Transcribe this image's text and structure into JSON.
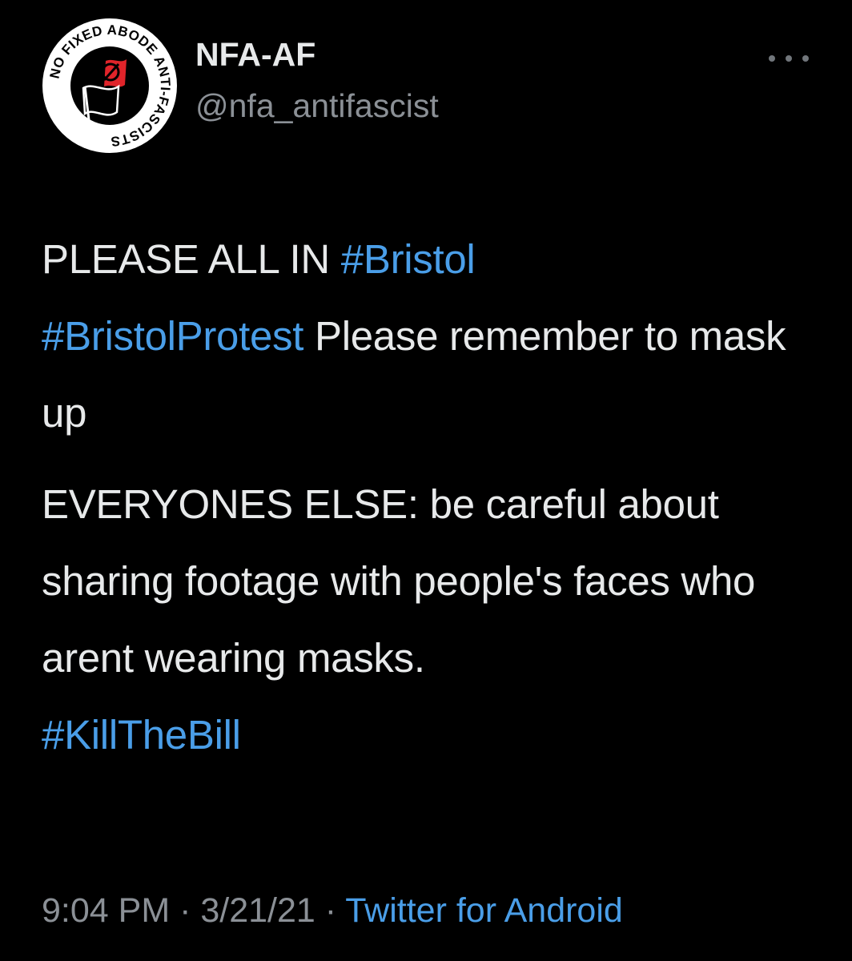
{
  "account": {
    "display_name": "NFA-AF",
    "handle": "@nfa_antifascist",
    "avatar_text": "NO FIXED ABODE ANTI-FASCISTS"
  },
  "tweet": {
    "line1_text": "PLEASE ALL IN ",
    "hashtag1": "#Bristol",
    "hashtag2": "#BristolProtest",
    "line2_text": " Please remember to mask up",
    "para2_text": "EVERYONES ELSE: be careful about sharing footage with people's faces who arent wearing masks.",
    "hashtag3": "#KillTheBill"
  },
  "meta": {
    "time": "9:04 PM",
    "separator": " · ",
    "date": "3/21/21",
    "source": "Twitter for Android"
  },
  "icons": {
    "more": "more-icon",
    "avatar": "antifa-flag-logo"
  },
  "colors": {
    "background": "#000000",
    "text": "#e7e9ea",
    "secondary": "#8b9096",
    "link": "#4a9ee8"
  }
}
